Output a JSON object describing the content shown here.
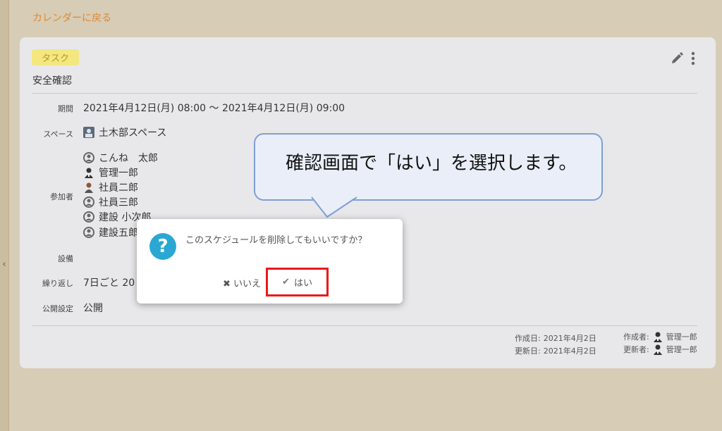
{
  "nav": {
    "back_label": "カレンダーに戻る"
  },
  "event": {
    "tag": "タスク",
    "title": "安全確認",
    "period_label": "期間",
    "period_value": "2021年4月12日(月) 08:00 ～ 2021年4月12日(月) 09:00",
    "space_label": "スペース",
    "space_value": "土木部スペース",
    "participants_label": "参加者",
    "participants": [
      "こんね　太郎",
      "管理一郎",
      "社員二郎",
      "社員三郎",
      "建設 小次郎",
      "建設五郎"
    ],
    "facility_label": "設備",
    "repeat_label": "繰り返し",
    "repeat_value": "7日ごと 20",
    "visibility_label": "公開設定",
    "visibility_value": "公開"
  },
  "meta": {
    "created_label": "作成日:",
    "created_value": "2021年4月2日",
    "creator_label": "作成者:",
    "creator_value": "管理一郎",
    "updated_label": "更新日:",
    "updated_value": "2021年4月2日",
    "updater_label": "更新者:",
    "updater_value": "管理一郎"
  },
  "callout": {
    "text": "確認画面で「はい」を選択します。"
  },
  "dialog": {
    "message": "このスケジュールを削除してもいいですか？",
    "no_label": "いいえ",
    "yes_label": "はい"
  },
  "colors": {
    "accent": "#e0892f",
    "dialog_icon": "#2aa7d3",
    "highlight": "#e81a1a",
    "tag_bg": "#f4e77f"
  },
  "icons": [
    "chevron-left-icon",
    "pencil-icon",
    "more-vertical-icon",
    "space-icon",
    "user-icon",
    "avatar-icon",
    "question-icon",
    "x-icon",
    "check-icon"
  ]
}
